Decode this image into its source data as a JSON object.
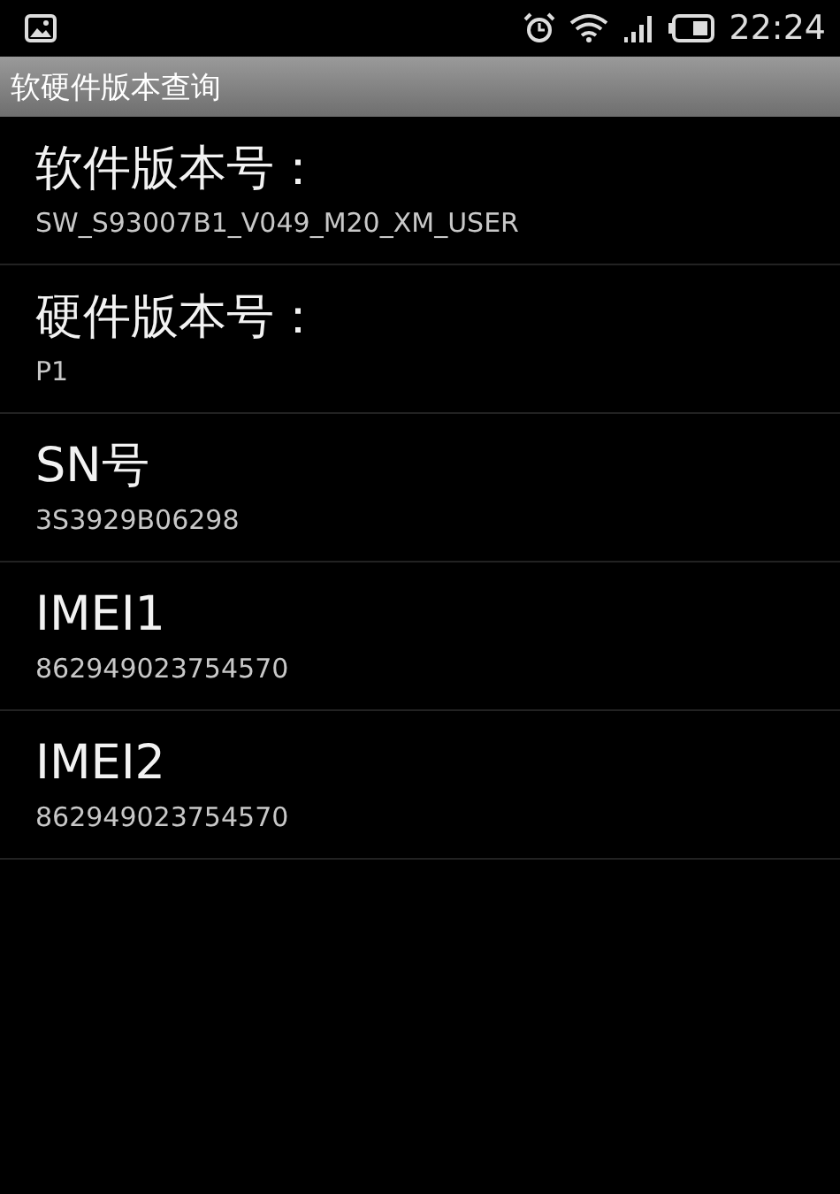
{
  "status_bar": {
    "time": "22:24"
  },
  "title_bar": {
    "title": "软硬件版本查询"
  },
  "items": [
    {
      "label": "软件版本号：",
      "value": "SW_S93007B1_V049_M20_XM_USER"
    },
    {
      "label": "硬件版本号：",
      "value": "P1"
    },
    {
      "label": "SN号",
      "value": "3S3929B06298"
    },
    {
      "label": "IMEI1",
      "value": "862949023754570"
    },
    {
      "label": "IMEI2",
      "value": "862949023754570"
    }
  ]
}
